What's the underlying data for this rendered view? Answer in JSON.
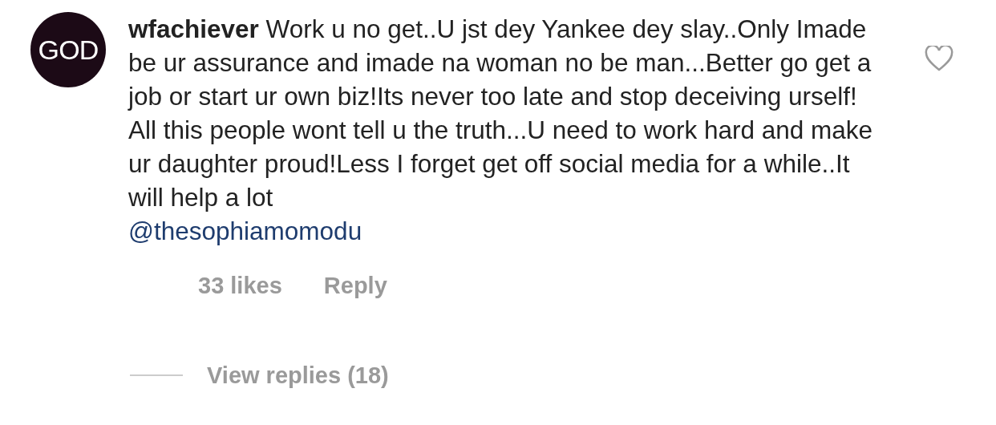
{
  "comment": {
    "avatar_text": "GOD",
    "username": "wfachiever",
    "text": "Work u no get..U jst dey Yankee dey slay..Only Imade be ur assurance and imade na woman no be man...Better go get a job or start ur own biz!Its never too late and stop deceiving urself! All this people wont tell u the truth...U need to work hard and make ur daughter proud!Less I forget get off social media for a while..It will help a lot",
    "mention": "@thesophiamomodu",
    "liked": false,
    "likes": "33 likes",
    "reply": "Reply",
    "view_replies": "View replies (18)"
  }
}
